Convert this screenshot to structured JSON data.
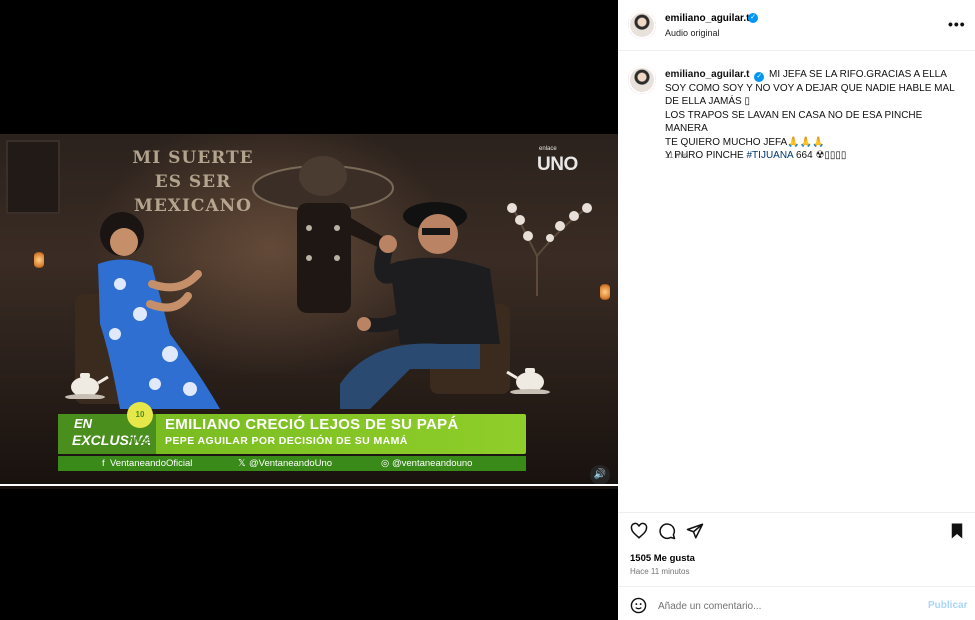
{
  "video": {
    "poster_text": "MI SUERTE ES SER MEXICANO",
    "tv_logo": "UNO",
    "tv_logo_small": "enlace",
    "lower_third": {
      "badge_line1": "EN",
      "badge_line2": "EXCLUSIVA",
      "years_badge": "10 AÑOS",
      "headline": "EMILIANO CRECIÓ LEJOS DE SU PAPÁ",
      "subheadline": "PEPE AGUILAR POR DECISIÓN DE SU MAMÁ",
      "social_facebook": "VentaneandoOficial",
      "social_x": "@VentaneandoUno",
      "social_instagram": "@ventaneandouno"
    },
    "progress": 1.0
  },
  "post": {
    "header": {
      "username": "emiliano_aguilar.t",
      "subtitle": "Audio original"
    },
    "caption": {
      "username": "emiliano_aguilar.t",
      "line1": "MI JEFA SE LA RIFO.GRACIAS A ELLA SOY COMO SOY Y NO VOY A DEJAR QUE NADIE HABLE MAL DE ELLA JAMÁS ▯",
      "line2": "LOS TRAPOS SE LAVAN EN CASA NO DE ESA PINCHE MANERA",
      "line3": "TE QUIERO MUCHO JEFA🙏🙏🙏",
      "line4_prefix": "Y PURO PINCHE ",
      "line4_hashtag": "#TIJUANA",
      "line4_suffix": " 664 ☢▯▯▯▯",
      "time": "11 min"
    },
    "likes": "1505 Me gusta",
    "posted_ago": "Hace 11 minutos",
    "comment_placeholder": "Añade un comentario...",
    "publish_label": "Publicar"
  },
  "icons": {
    "like": "heart-icon",
    "comment": "comment-icon",
    "share": "paper-plane-icon",
    "save": "bookmark-icon",
    "emoji": "emoji-icon",
    "more": "more-icon",
    "mute": "volume-icon",
    "verified": "verified-badge-icon"
  },
  "colors": {
    "lower_third_green": "#8fce2a",
    "lower_third_dark_green": "#4a8e1e",
    "verified_blue": "#0095f6",
    "hashtag": "#00376b",
    "publish_disabled": "#a9d5fb"
  }
}
